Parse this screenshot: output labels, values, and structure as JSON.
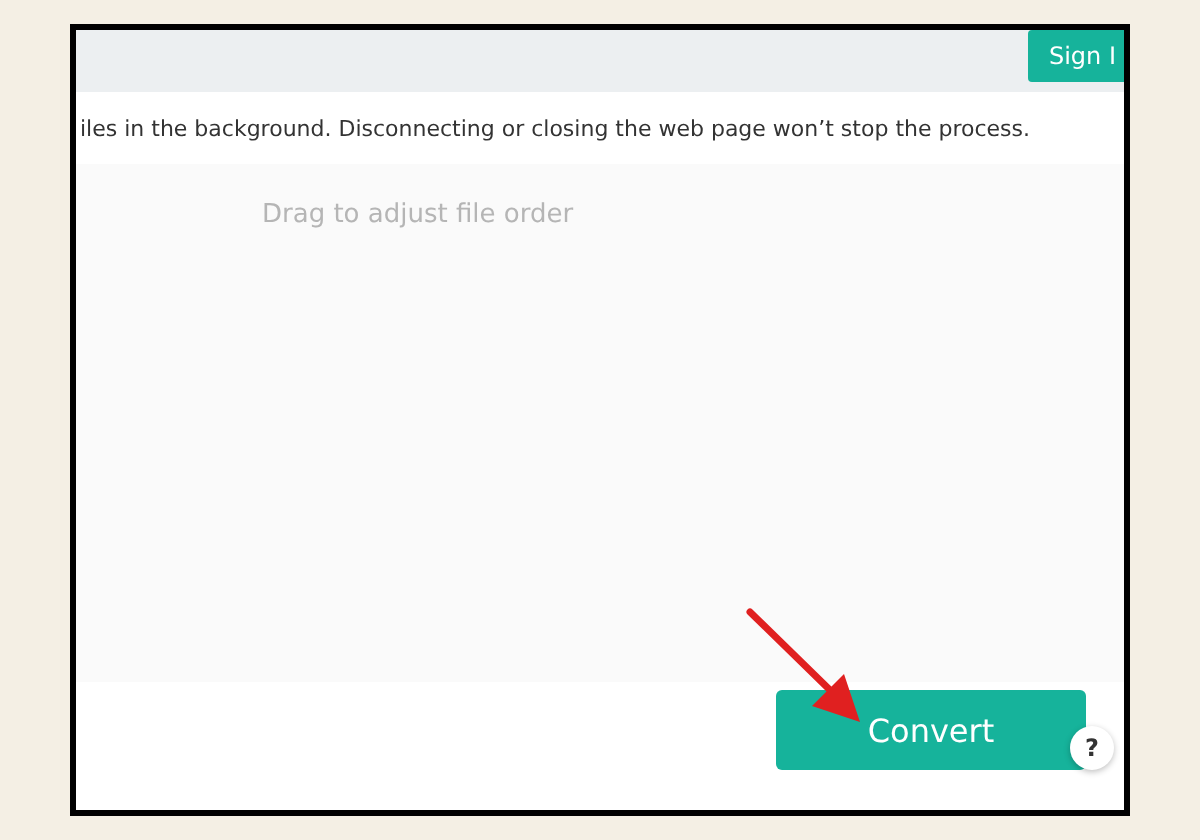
{
  "header": {
    "sign_in_button": "Sign I"
  },
  "notice": "iles in the background. Disconnecting or closing the web page won’t stop the process.",
  "drop_area": {
    "hint": "Drag to adjust file order"
  },
  "footer": {
    "convert_button": "Convert",
    "help_button": "?"
  }
}
